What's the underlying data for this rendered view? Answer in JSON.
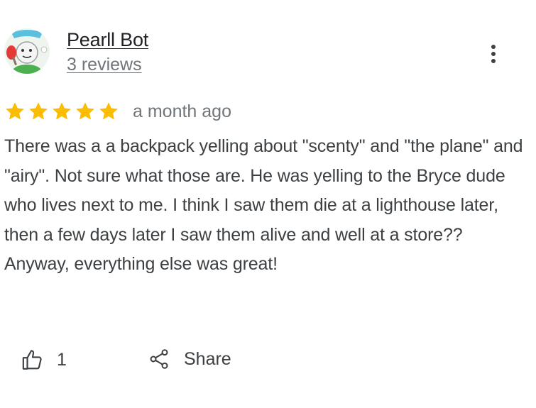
{
  "author": {
    "name": "Pearll Bot",
    "reviews_count": "3 reviews",
    "avatar_icon": "cartoon-character-avatar"
  },
  "more_options_icon": "vertical-dots-icon",
  "rating": {
    "stars": 5,
    "max_stars": 5,
    "star_color": "#fbbc04"
  },
  "date": "a month ago",
  "text": "There was a a backpack yelling about \"scenty\" and \"the plane\" and \"airy\". Not sure what those are. He was yelling to the Bryce dude who lives next to me. I think I saw them die at a lighthouse later, then a few days later I saw them alive and well at a store?? Anyway, everything else was great!",
  "actions": {
    "like_count": "1",
    "like_icon": "thumbs-up-icon",
    "share_label": "Share",
    "share_icon": "share-icon"
  }
}
